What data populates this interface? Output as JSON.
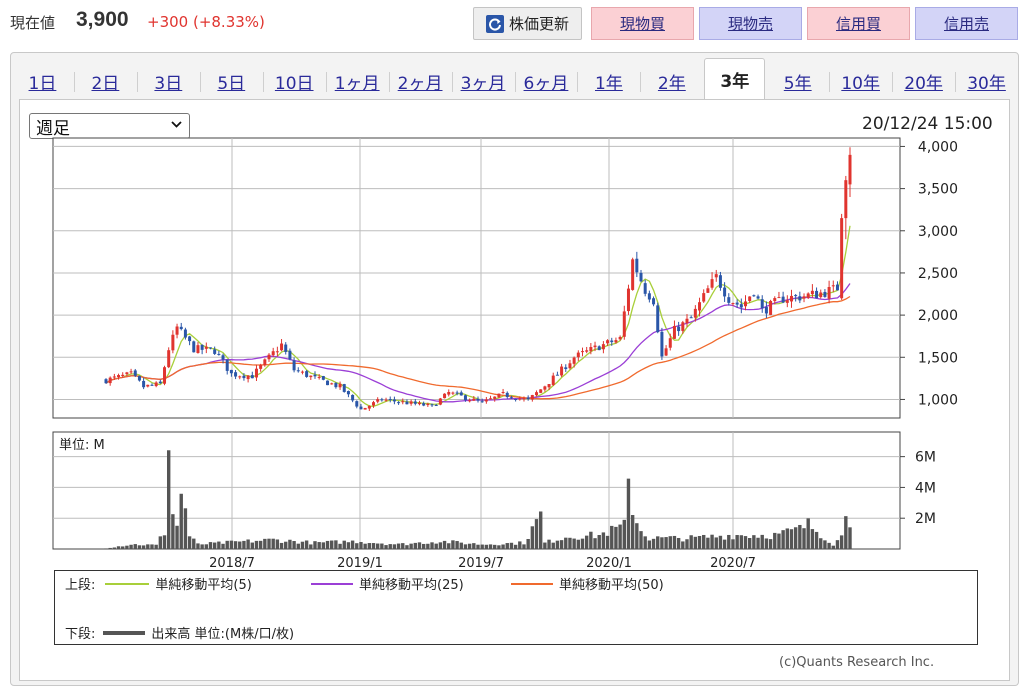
{
  "header": {
    "price_label": "現在値",
    "price_value": "3,900",
    "price_change": "+300 (+8.33%)",
    "buttons": {
      "refresh": "株価更新",
      "spot_buy": "現物買",
      "spot_sell": "現物売",
      "margin_buy": "信用買",
      "margin_sell": "信用売"
    },
    "colors": {
      "up": "#e0342f",
      "buy_bg": "#fbd0d4",
      "sell_bg": "#d3d4f7",
      "refresh_icon": "#2a56a8"
    },
    "refresh_icon": "refresh-icon"
  },
  "tabs": [
    {
      "label": "1日",
      "active": false
    },
    {
      "label": "2日",
      "active": false
    },
    {
      "label": "3日",
      "active": false
    },
    {
      "label": "5日",
      "active": false
    },
    {
      "label": "10日",
      "active": false
    },
    {
      "label": "1ヶ月",
      "active": false
    },
    {
      "label": "2ヶ月",
      "active": false
    },
    {
      "label": "3ヶ月",
      "active": false
    },
    {
      "label": "6ヶ月",
      "active": false
    },
    {
      "label": "1年",
      "active": false
    },
    {
      "label": "2年",
      "active": false
    },
    {
      "label": "3年",
      "active": true
    },
    {
      "label": "5年",
      "active": false
    },
    {
      "label": "10年",
      "active": false
    },
    {
      "label": "20年",
      "active": false
    },
    {
      "label": "30年",
      "active": false
    }
  ],
  "controls": {
    "period_selected": "週足",
    "timestamp": "20/12/24 15:00"
  },
  "legend": {
    "upper_label": "上段:",
    "lower_label": "下段:",
    "ma5": "単純移動平均(5)",
    "ma25": "単純移動平均(25)",
    "ma50": "単純移動平均(50)",
    "volume": "出来高 単位:(M株/口/枚)",
    "ma5_color": "#a8cf3a",
    "ma25_color": "#9b3fd6",
    "ma50_color": "#f06a2e"
  },
  "copyright": "(c)Quants Research Inc.",
  "chart_data": [
    {
      "type": "candlestick",
      "title": "",
      "yticks": [
        1000,
        1500,
        2000,
        2500,
        3000,
        3500,
        4000
      ],
      "ytick_labels": [
        "1,000",
        "1,500",
        "2,000",
        "2,500",
        "3,000",
        "3,500",
        "4,000"
      ],
      "ylim": [
        780,
        4100
      ],
      "xticks": [
        "2018/7",
        "2019/1",
        "2019/7",
        "2020/1",
        "2020/7"
      ],
      "grid": true,
      "up_color": "#e0342f",
      "down_color": "#2a56a8",
      "price_keyframes": [
        [
          0,
          1230
        ],
        [
          6,
          1300
        ],
        [
          9,
          1150
        ],
        [
          13,
          1180
        ],
        [
          15,
          1600
        ],
        [
          17,
          1850
        ],
        [
          21,
          1600
        ],
        [
          26,
          1580
        ],
        [
          30,
          1300
        ],
        [
          35,
          1280
        ],
        [
          40,
          1550
        ],
        [
          42,
          1650
        ],
        [
          45,
          1350
        ],
        [
          50,
          1250
        ],
        [
          56,
          1150
        ],
        [
          61,
          880
        ],
        [
          66,
          1000
        ],
        [
          72,
          960
        ],
        [
          78,
          920
        ],
        [
          82,
          1080
        ],
        [
          86,
          1020
        ],
        [
          90,
          960
        ],
        [
          95,
          1060
        ],
        [
          101,
          990
        ],
        [
          104,
          1120
        ],
        [
          108,
          1300
        ],
        [
          112,
          1500
        ],
        [
          118,
          1630
        ],
        [
          123,
          1720
        ],
        [
          126,
          2650
        ],
        [
          129,
          2300
        ],
        [
          131,
          2180
        ],
        [
          133,
          1500
        ],
        [
          136,
          1820
        ],
        [
          140,
          1960
        ],
        [
          144,
          2300
        ],
        [
          146,
          2450
        ],
        [
          149,
          2200
        ],
        [
          152,
          2100
        ],
        [
          155,
          2300
        ],
        [
          157,
          2050
        ],
        [
          162,
          2200
        ],
        [
          166,
          2220
        ],
        [
          170,
          2250
        ],
        [
          174,
          2300
        ],
        [
          176,
          2350
        ],
        [
          178,
          3900
        ]
      ],
      "special_candles": [
        {
          "i": 176,
          "o": 2200,
          "c": 3150,
          "h": 3200,
          "l": 2180
        },
        {
          "i": 177,
          "o": 3150,
          "c": 3600,
          "h": 3650,
          "l": 2900
        },
        {
          "i": 178,
          "o": 3550,
          "c": 3900,
          "h": 3990,
          "l": 3400
        }
      ],
      "series": [
        {
          "name": "単純移動平均(5)",
          "window": 5,
          "color": "#a8cf3a"
        },
        {
          "name": "単純移動平均(25)",
          "window": 25,
          "color": "#9b3fd6"
        },
        {
          "name": "単純移動平均(50)",
          "window": 50,
          "color": "#f06a2e"
        }
      ]
    },
    {
      "type": "bar",
      "unit_label": "単位: M",
      "yticks": [
        2,
        4,
        6
      ],
      "ytick_labels": [
        "2M",
        "4M",
        "6M"
      ],
      "ylim": [
        0,
        7.6
      ],
      "color": "#555555",
      "volume_keyframes": [
        [
          0,
          0.05
        ],
        [
          6,
          0.3
        ],
        [
          12,
          0.25
        ],
        [
          14,
          1.1
        ],
        [
          15,
          7.4
        ],
        [
          16,
          2.2
        ],
        [
          17,
          1.6
        ],
        [
          18,
          3.4
        ],
        [
          19,
          2.8
        ],
        [
          20,
          0.8
        ],
        [
          22,
          0.3
        ],
        [
          40,
          0.6
        ],
        [
          50,
          0.4
        ],
        [
          60,
          0.5
        ],
        [
          70,
          0.3
        ],
        [
          80,
          0.5
        ],
        [
          90,
          0.3
        ],
        [
          100,
          0.4
        ],
        [
          104,
          2.2
        ],
        [
          105,
          0.4
        ],
        [
          110,
          0.8
        ],
        [
          118,
          0.9
        ],
        [
          124,
          1.5
        ],
        [
          125,
          4.1
        ],
        [
          126,
          2.8
        ],
        [
          127,
          1.8
        ],
        [
          128,
          1.2
        ],
        [
          130,
          0.7
        ],
        [
          140,
          0.7
        ],
        [
          150,
          0.9
        ],
        [
          160,
          0.9
        ],
        [
          166,
          1.3
        ],
        [
          168,
          1.6
        ],
        [
          170,
          1.2
        ],
        [
          174,
          0.3
        ],
        [
          176,
          0.8
        ],
        [
          177,
          2.6
        ],
        [
          178,
          2.0
        ]
      ]
    }
  ]
}
